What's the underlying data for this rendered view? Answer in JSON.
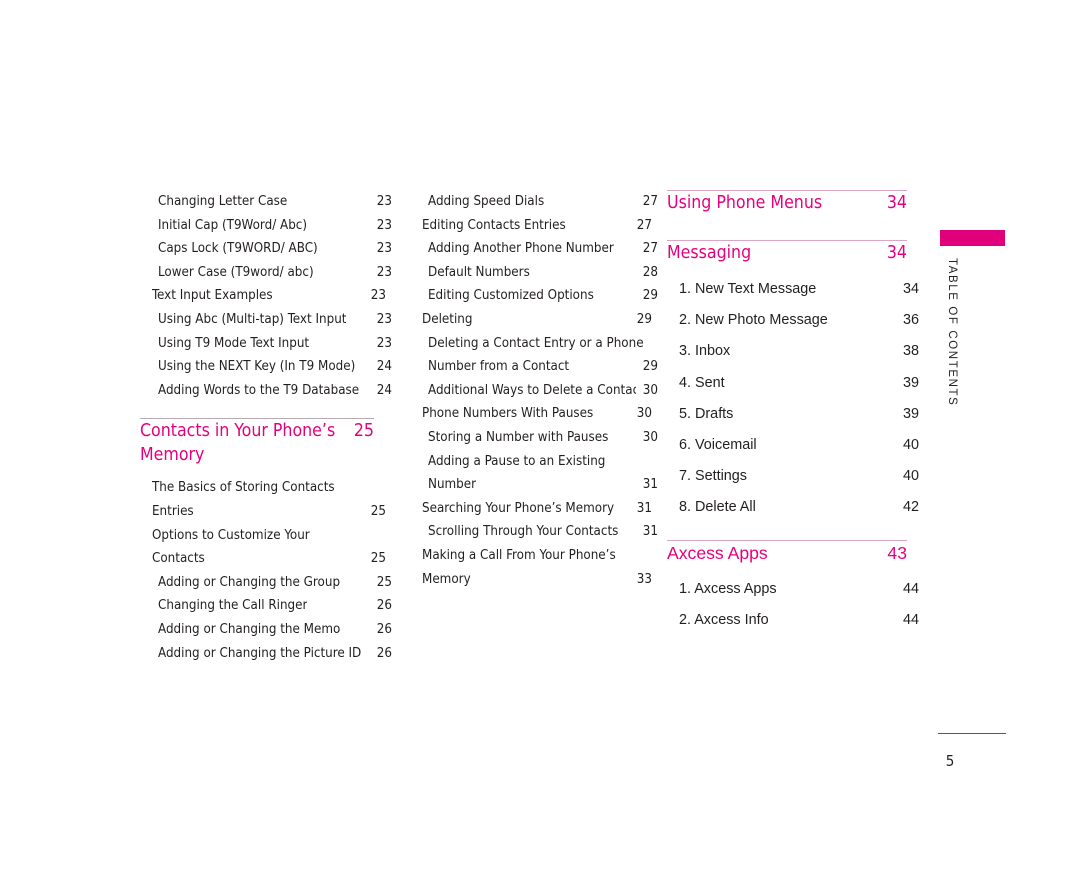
{
  "page": {
    "folio": "5",
    "sidebar_label": "TABLE OF CONTENTS",
    "accent_color": "#e6007e",
    "tab_color": "#e0007c",
    "rule_color": "#d9a7c4"
  },
  "columns": [
    {
      "id": "col-1",
      "blocks": [
        {
          "type": "entries",
          "rows": [
            {
              "level": 2,
              "text": "Changing Letter Case",
              "page": "23"
            },
            {
              "level": 2,
              "text": "Initial Cap (T9Word/ Abc)",
              "page": "23"
            },
            {
              "level": 2,
              "text": "Caps Lock (T9WORD/ ABC)",
              "page": "23"
            },
            {
              "level": 2,
              "text": "Lower Case (T9word/ abc)",
              "page": "23"
            },
            {
              "level": 1,
              "text": "Text Input Examples",
              "page": "23"
            },
            {
              "level": 2,
              "text": "Using Abc (Multi-tap) Text Input",
              "page": "23"
            },
            {
              "level": 2,
              "text": "Using T9 Mode Text Input",
              "page": "23"
            },
            {
              "level": 2,
              "text": "Using the NEXT Key (In T9 Mode)",
              "page": "24"
            },
            {
              "level": 2,
              "text": "Adding Words to the T9 Database",
              "page": "24"
            }
          ]
        },
        {
          "type": "section",
          "rule": "gray",
          "title": "Contacts in Your Phone’s Memory",
          "page": "25"
        },
        {
          "type": "entries",
          "rows": [
            {
              "level": 1,
              "text": "The Basics of Storing Contacts",
              "page": "",
              "cont": true
            },
            {
              "level": 1,
              "text": "Entries",
              "page": "25"
            },
            {
              "level": 1,
              "text": "Options to Customize Your",
              "page": "",
              "cont": true
            },
            {
              "level": 1,
              "text": "Contacts",
              "page": "25"
            },
            {
              "level": 2,
              "text": "Adding or Changing the Group",
              "page": "25"
            },
            {
              "level": 2,
              "text": "Changing the Call Ringer",
              "page": "26"
            },
            {
              "level": 2,
              "text": "Adding or Changing the Memo",
              "page": "26"
            },
            {
              "level": 2,
              "text": "Adding or Changing the Picture ID",
              "page": "26"
            }
          ]
        }
      ]
    },
    {
      "id": "col-2",
      "blocks": [
        {
          "type": "entries",
          "rows": [
            {
              "level": 2,
              "text": "Adding Speed Dials",
              "page": "27"
            },
            {
              "level": 1,
              "text": "Editing Contacts Entries",
              "page": "27"
            },
            {
              "level": 2,
              "text": "Adding Another Phone Number",
              "page": "27"
            },
            {
              "level": 2,
              "text": "Default Numbers",
              "page": "28"
            },
            {
              "level": 2,
              "text": "Editing Customized Options",
              "page": "29"
            },
            {
              "level": 1,
              "text": "Deleting",
              "page": "29"
            },
            {
              "level": 2,
              "text": "Deleting a Contact Entry or a Phone",
              "page": "",
              "cont": true
            },
            {
              "level": 2,
              "text": "Number from a Contact",
              "page": "29"
            },
            {
              "level": 2,
              "text": "Additional Ways to Delete a Contact",
              "page": "30"
            },
            {
              "level": 1,
              "text": "Phone Numbers With Pauses",
              "page": "30"
            },
            {
              "level": 2,
              "text": "Storing a Number with Pauses",
              "page": "30"
            },
            {
              "level": 2,
              "text": "Adding a Pause to an Existing",
              "page": "",
              "cont": true
            },
            {
              "level": 2,
              "text": "Number",
              "page": "31"
            },
            {
              "level": 1,
              "text": "Searching Your Phone’s Memory",
              "page": "31"
            },
            {
              "level": 2,
              "text": "Scrolling Through Your Contacts",
              "page": "31"
            },
            {
              "level": 1,
              "text": "Making a Call From Your Phone’s",
              "page": "",
              "cont": true
            },
            {
              "level": 1,
              "text": "Memory",
              "page": "33"
            }
          ]
        }
      ]
    },
    {
      "id": "col-3",
      "blocks": [
        {
          "type": "section",
          "rule": "pink",
          "title": "Using Phone Menus",
          "page": "34"
        },
        {
          "type": "section",
          "rule": "pink",
          "title": "Messaging",
          "page": "34"
        },
        {
          "type": "entries",
          "rows": [
            {
              "level": 1,
              "text": "1. New Text Message",
              "page": "34"
            },
            {
              "level": 1,
              "text": "2. New Photo Message",
              "page": "36"
            },
            {
              "level": 1,
              "text": "3. Inbox",
              "page": "38"
            },
            {
              "level": 1,
              "text": "4. Sent",
              "page": "39"
            },
            {
              "level": 1,
              "text": "5. Drafts",
              "page": "39"
            },
            {
              "level": 1,
              "text": "6. Voicemail",
              "page": "40"
            },
            {
              "level": 1,
              "text": "7. Settings",
              "page": "40"
            },
            {
              "level": 1,
              "text": "8. Delete All",
              "page": "42"
            }
          ]
        },
        {
          "type": "section",
          "rule": "pink",
          "alt": true,
          "title": "Axcess Apps",
          "page": "43"
        },
        {
          "type": "entries",
          "rows": [
            {
              "level": 1,
              "text": "1. Axcess Apps",
              "page": "44"
            },
            {
              "level": 1,
              "text": "2. Axcess Info",
              "page": "44"
            }
          ]
        }
      ]
    }
  ]
}
